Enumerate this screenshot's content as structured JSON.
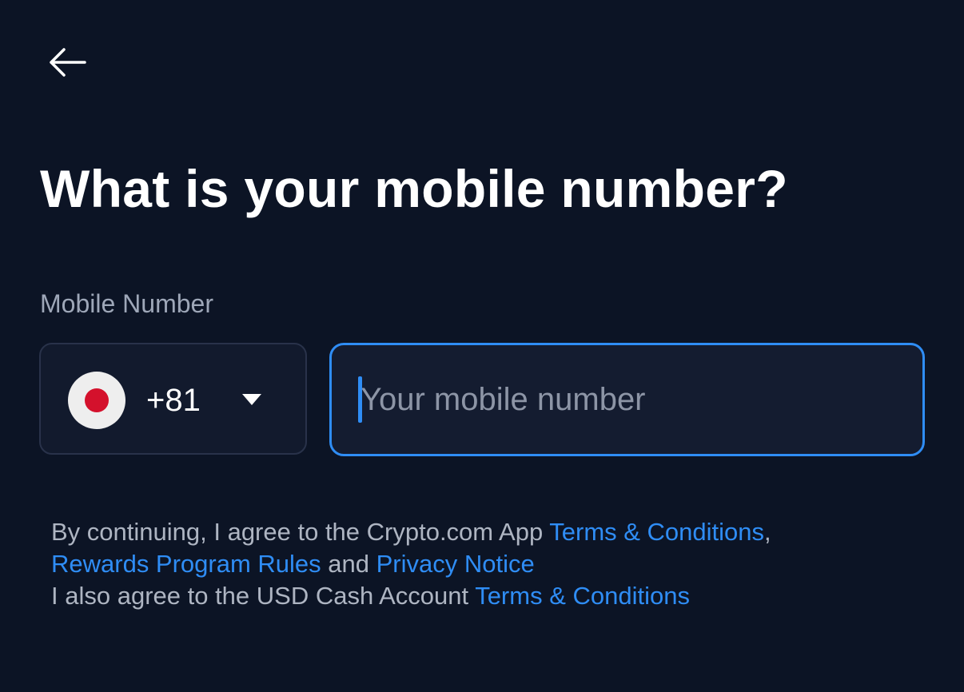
{
  "header": {
    "back_icon": "arrow-left-icon"
  },
  "title": "What is your mobile number?",
  "mobile_field": {
    "label": "Mobile Number",
    "country": {
      "flag_icon": "japan-flag-icon",
      "dial_code": "+81",
      "chevron_icon": "chevron-down-icon"
    },
    "input": {
      "placeholder": "Your mobile number",
      "value": ""
    }
  },
  "legal": {
    "line1_text": "By continuing, I agree to the Crypto.com App ",
    "terms_link": "Terms & Conditions",
    "comma": ",",
    "rewards_link": "Rewards Program Rules",
    "and_text": " and ",
    "privacy_link": "Privacy Notice",
    "line3_text": "I also agree to the USD Cash Account ",
    "usd_terms_link": "Terms & Conditions"
  },
  "colors": {
    "background": "#0c1425",
    "accent": "#2f8df5",
    "flag_red": "#d4112c"
  }
}
